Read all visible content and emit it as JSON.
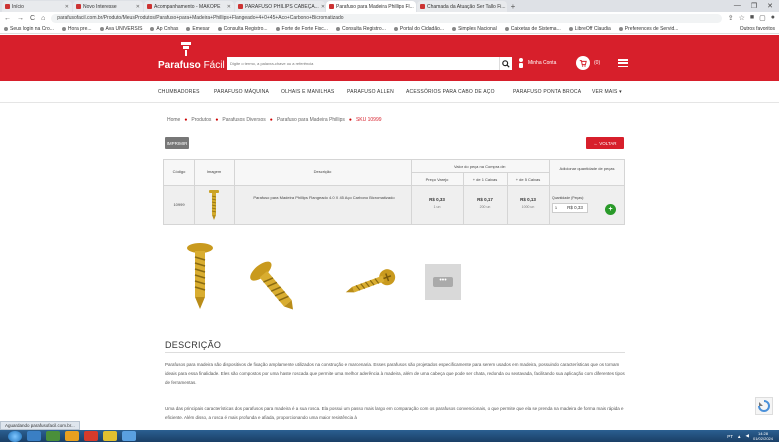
{
  "browser": {
    "tabs": [
      {
        "label": "Início",
        "active": false
      },
      {
        "label": "Novo Interesse",
        "active": false
      },
      {
        "label": "Acompanhamento - MAKOPE",
        "active": false
      },
      {
        "label": "PARAFUSO PHILIPS CABEÇA...",
        "active": false
      },
      {
        "label": "Parafuso para Madeira Phillips Fl...",
        "active": true
      },
      {
        "label": "Chamada da Atuação Ser Tallo Fi...",
        "active": false
      }
    ],
    "new_tab": "+",
    "window_controls": [
      "—",
      "❐",
      "✕"
    ],
    "url": "parafusofacil.com.br/Produto/MeusProdutos/Parafuso+para+Madeira+Phillips+Flangeado+4+0+45+Aco+Carbono+Bicromatizado",
    "nav_icons": [
      "←",
      "→",
      "C",
      "⌂"
    ],
    "bookmarks": [
      "Seus login na Cro...",
      "Hora pre...",
      "Ava UNIVERSIS",
      "Ap Cnhas",
      "Emesar",
      "Consulta Registro...",
      "Forte de Forte Fisc...",
      "Consulta Registro...",
      "Portal do Cidadão...",
      "Simples Nacional",
      "Caixetas de Sistema...",
      "LibreOff Claudia",
      "Preferences de Servid..."
    ],
    "bookmarks_more": "Outros favoritos"
  },
  "header": {
    "logo": {
      "bold": "Parafuso",
      "thin": " Fácil"
    },
    "search_placeholder": "Digite o termo, a palavra-chave ou a referência",
    "user_name": "Minha Conta",
    "cart_count": "(0)",
    "accent_color": "#d71f2b"
  },
  "nav": {
    "items": [
      "CHUMBADORES",
      "PARAFUSO MÁQUINA",
      "OLHAIS E MANILHAS",
      "PARAFUSO ALLEN",
      "ACESSÓRIOS PARA CABO DE AÇO",
      "PARAFUSO PONTA BROCA",
      "VER MAIS"
    ]
  },
  "breadcrumb": [
    "Home",
    "Produtos",
    "Parafusos Diversos",
    "Parafuso para Madeira Phillips",
    "SKU 10999"
  ],
  "buttons": {
    "print": "IMPRIMIR",
    "back": "← VOLTAR"
  },
  "table": {
    "headers": {
      "code": "Código",
      "image": "Imagem",
      "description": "Descrição",
      "price_group": "Valor do peça na Compra de:",
      "price_cols": [
        "Preço Varejo",
        "+ de 1 Caixas",
        "+ de 5 Caixas"
      ],
      "add": "Adicionar quantidade de peças"
    },
    "row": {
      "code": "10999",
      "description": "Parafuso para Madeira Phillips Flangeado 4.0 X 45 Aço Carbono Bicromatizado",
      "prices": [
        {
          "value": "R$ 0,33",
          "unit": "1 un"
        },
        {
          "value": "R$ 0,17",
          "unit": "200 un"
        },
        {
          "value": "R$ 0,13",
          "unit": "1000 un"
        }
      ],
      "qty_label": "Quantidade (Peças):",
      "qty_value": "1",
      "qty_price": "R$ 0,33",
      "add_symbol": "+"
    }
  },
  "gallery": {
    "more": "•••"
  },
  "description": {
    "title": "DESCRIÇÃO",
    "paragraphs": [
      "Parafusos para madeira são dispositivos de fixação amplamente utilizados na construção e marcenaria. Esses parafusos são projetados especificamente para serem usados em madeira, possuindo características que os tornam ideais para essa finalidade. Eles são compostos por uma haste roscada que permite uma melhor aderência à madeira, além de uma cabeça que pode ser chata, redonda ou sextavada, facilitando sua aplicação com diferentes tipos de ferramentas.",
      "Uma das principais características dos parafusos para madeira é a sua rosca. Ela possui um passo mais largo em comparação com os parafusos convencionais, o que permite que ela se prenda na madeira de forma mais rápida e eficiente. Além disso, a rosca é mais profunda e afiada, proporcionando uma maior resistência à"
    ]
  },
  "status_text": "Aguardando parafusofacil.com.br...",
  "taskbar": {
    "tray_text": "PT",
    "time": "14:28",
    "date": "01/02/2024"
  }
}
